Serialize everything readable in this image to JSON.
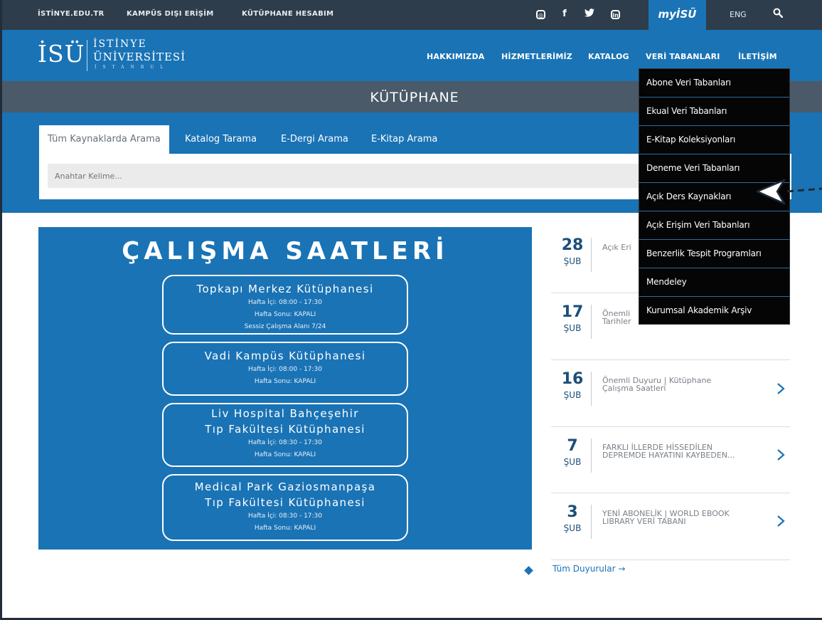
{
  "topbar": {
    "links": [
      "İSTİNYE.EDU.TR",
      "KAMPÜS DIŞI ERİŞİM",
      "KÜTÜPHANE HESABIM"
    ],
    "social_icons": [
      "instagram-icon",
      "facebook-icon",
      "twitter-icon",
      "linkedin-icon"
    ],
    "social_glyphs": [
      "◎",
      "f",
      "🐦",
      "in"
    ],
    "myisu": "myİSÜ",
    "lang": "ENG",
    "search_icon": "search-icon"
  },
  "header": {
    "logo_abbr": "İSÜ",
    "logo_line1": "İSTİNYE",
    "logo_line2": "ÜNİVERSİTESİ",
    "logo_line3": "İSTANBUL",
    "nav": [
      "HAKKIMIZDA",
      "HİZMETLERİMİZ",
      "KATALOG",
      "VERİ TABANLARI",
      "İLETİŞİM"
    ]
  },
  "band": {
    "title": "KÜTÜPHANE"
  },
  "search": {
    "tabs": [
      "Tüm Kaynaklarda Arama",
      "Katalog Tarama",
      "E-Dergi Arama",
      "E-Kitap Arama"
    ],
    "placeholder": "Anahtar Kelime..."
  },
  "hours": {
    "title": "ÇALIŞMA SAATLERİ",
    "libraries": [
      {
        "name": [
          "Topkapı Merkez Kütüphanesi"
        ],
        "lines": [
          "Hafta İçi: 08:00 - 17:30",
          "Hafta Sonu: KAPALI",
          "Sessiz Çalışma Alanı 7/24"
        ]
      },
      {
        "name": [
          "Vadi Kampüs Kütüphanesi"
        ],
        "lines": [
          "Hafta İçi: 08:00 - 17:30",
          "Hafta Sonu: KAPALI"
        ]
      },
      {
        "name": [
          "Liv Hospital Bahçeşehir",
          "Tıp Fakültesi Kütüphanesi"
        ],
        "lines": [
          "Hafta İçi: 08:30 - 17:30",
          "Hafta Sonu: KAPALI"
        ]
      },
      {
        "name": [
          "Medical Park Gaziosmanpaşa",
          "Tıp Fakültesi Kütüphanesi"
        ],
        "lines": [
          "Hafta İçi: 08:30 - 17:30",
          "Hafta Sonu: KAPALI"
        ]
      }
    ]
  },
  "announcements": {
    "items": [
      {
        "day": "28",
        "month": "ŞUB",
        "text": [
          "Açık Eri"
        ]
      },
      {
        "day": "17",
        "month": "ŞUB",
        "text": [
          "Önemli",
          "Tarihler"
        ]
      },
      {
        "day": "16",
        "month": "ŞUB",
        "text": [
          "Önemli Duyuru | Kütüphane",
          "Çalışma Saatleri"
        ]
      },
      {
        "day": "7",
        "month": "ŞUB",
        "text": [
          "FARKLI İLLERDE HİSSEDİLEN",
          "DEPREMDE HAYATINI KAYBEDEN..."
        ]
      },
      {
        "day": "3",
        "month": "ŞUB",
        "text": [
          "YENİ ABONELİK | WORLD EBOOK",
          "LIBRARY VERİ TABANI"
        ]
      }
    ],
    "all_link": "Tüm Duyurular →"
  },
  "dropdown": {
    "items": [
      "Abone Veri Tabanları",
      "Ekual Veri Tabanları",
      "E-Kitap Koleksiyonları",
      "Deneme Veri Tabanları",
      "Açık Ders Kaynakları",
      "Açık Erişim Veri Tabanları",
      "Benzerlik Tespit Programları",
      "Mendeley",
      "Kurumsal Akademik Arşiv"
    ]
  }
}
